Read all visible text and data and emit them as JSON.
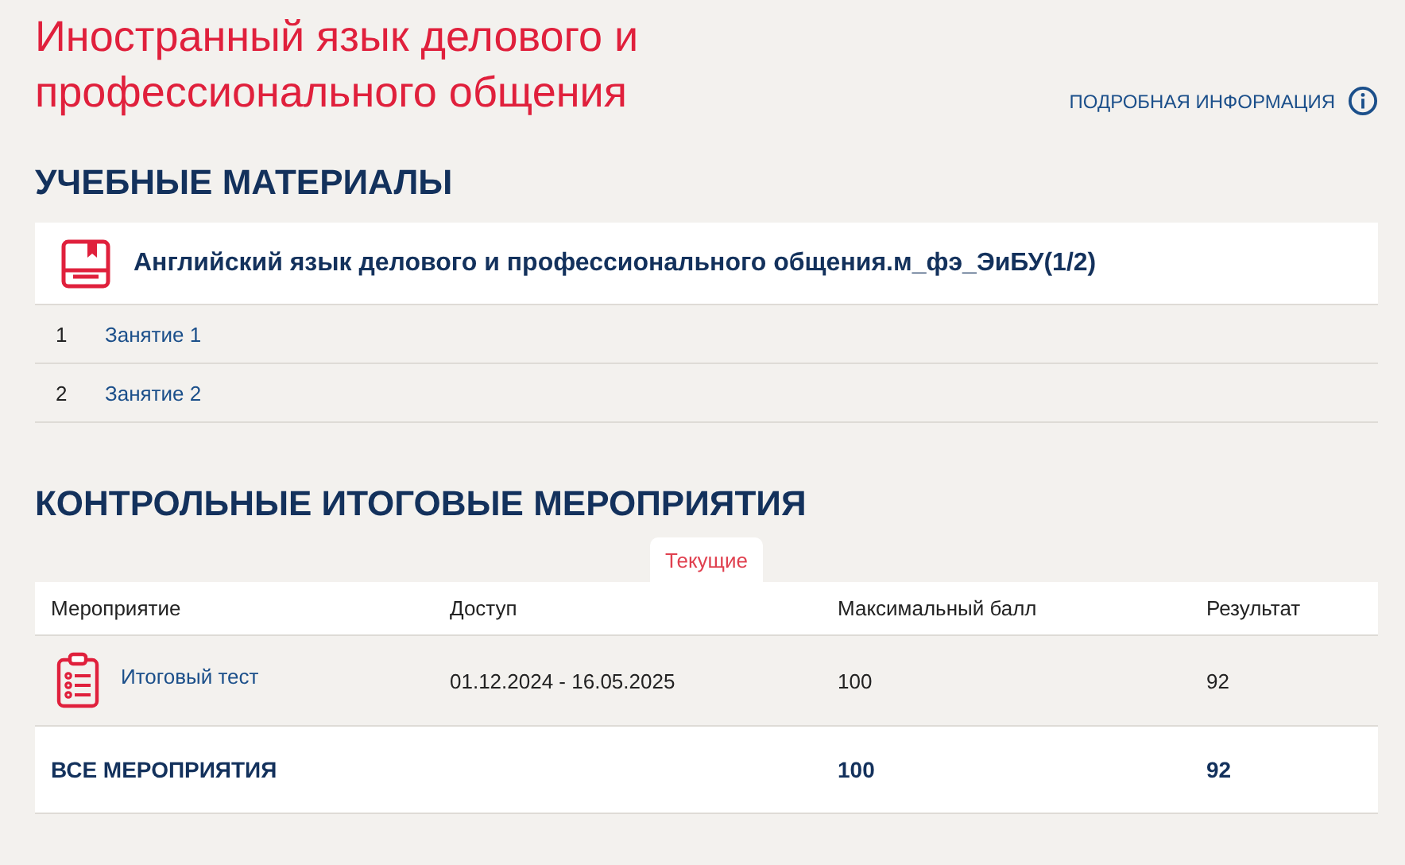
{
  "title": "Иностранный язык делового и профессионального общения",
  "info_link": "ПОДРОБНАЯ ИНФОРМАЦИЯ",
  "materials": {
    "heading": "УЧЕБНЫЕ МАТЕРИАЛЫ",
    "course": "Английский язык делового и профессионального общения.м_фэ_ЭиБУ(1/2)",
    "lessons": [
      {
        "number": "1",
        "title": "Занятие 1"
      },
      {
        "number": "2",
        "title": "Занятие 2"
      }
    ]
  },
  "assessments": {
    "heading": "КОНТРОЛЬНЫЕ ИТОГОВЫЕ МЕРОПРИЯТИЯ",
    "tabs": [
      {
        "label": "Текущие",
        "selected": true
      }
    ],
    "columns": [
      "Мероприятие",
      "Доступ",
      "Максимальный балл",
      "Результат"
    ],
    "rows": [
      {
        "name": "Итоговый тест",
        "access": "01.12.2024 - 16.05.2025",
        "max": "100",
        "result": "92"
      }
    ],
    "total": {
      "label": "ВСЕ МЕРОПРИЯТИЯ",
      "max": "100",
      "result": "92"
    }
  }
}
